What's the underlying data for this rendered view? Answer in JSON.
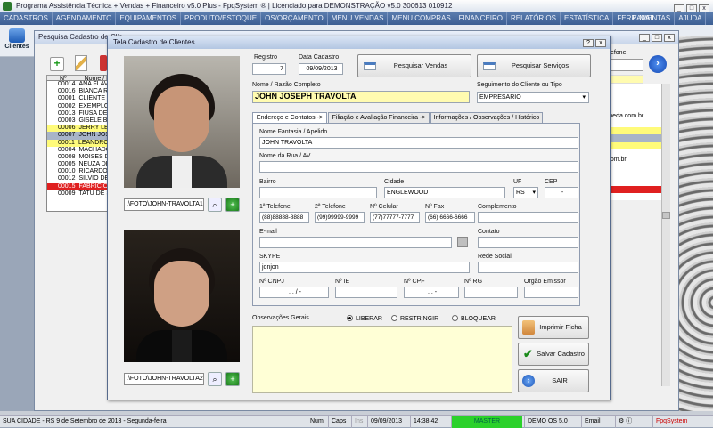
{
  "app_title": "Programa Assistência Técnica + Vendas + Financeiro v5.0 Plus - FpqSystem ® | Licenciado para  DEMONSTRAÇÃO v5.0 300613 010912",
  "menu": [
    "CADASTROS",
    "AGENDAMENTO",
    "EQUIPAMENTOS",
    "PRODUTO/ESTOQUE",
    "OS/ORÇAMENTO",
    "MENU VENDAS",
    "MENU COMPRAS",
    "FINANCEIRO",
    "RELATÓRIOS",
    "ESTATÍSTICA",
    "FERRAMENTAS",
    "AJUDA"
  ],
  "menu_email": "E-MAIL",
  "toolbar": {
    "clientes": "Clientes"
  },
  "bg_window": {
    "title": "Pesquisa Cadastro de Clie",
    "col_n": "Nº",
    "col_nome": "Nome / Ra",
    "rows": [
      {
        "n": "00014",
        "nome": "ANA FLAVI"
      },
      {
        "n": "00016",
        "nome": "BIANCA RA"
      },
      {
        "n": "00001",
        "nome": "CLIENTE D"
      },
      {
        "n": "00002",
        "nome": "EXEMPLO"
      },
      {
        "n": "00013",
        "nome": "FIUSA DE"
      },
      {
        "n": "00003",
        "nome": "GISELE BU"
      },
      {
        "n": "00006",
        "nome": "JERRY LE"
      },
      {
        "n": "00007",
        "nome": "JOHN JOS"
      },
      {
        "n": "00011",
        "nome": "LEANDRO"
      },
      {
        "n": "00004",
        "nome": "MACHADO"
      },
      {
        "n": "00008",
        "nome": "MOISES DE"
      },
      {
        "n": "00005",
        "nome": "NEUZA DE"
      },
      {
        "n": "00010",
        "nome": "RICARDO A"
      },
      {
        "n": "00012",
        "nome": "SILVIO DE"
      },
      {
        "n": "00015",
        "nome": "FABRICIO"
      },
      {
        "n": "00009",
        "nome": "TATU DE S"
      }
    ],
    "right_header": "Telefone",
    "right_rows": [
      "m.br",
      "",
      "m.br",
      "",
      "ealmeda.com.br",
      "",
      "",
      "",
      "",
      "",
      "es.com.br",
      "m.br",
      "",
      "",
      "",
      ""
    ]
  },
  "form": {
    "title": "Tela Cadastro de Clientes",
    "foto1": ".\\FOTO\\JOHN-TRAVOLTA1.",
    "foto2": ".\\FOTO\\JOHN-TRAVOLTA2.",
    "registro_label": "Registro",
    "registro": "7",
    "data_label": "Data Cadastro",
    "data": "09/09/2013",
    "pesq_vendas": "Pesquisar Vendas",
    "pesq_servicos": "Pesquisar Serviços",
    "nome_label": "Nome / Razão Completo",
    "nome": "JOHN JOSEPH TRAVOLTA",
    "seg_label": "Seguimento do Cliente ou Tipo",
    "seg": "EMPRESARIO",
    "tabs": [
      "Endereço e Contatos ->",
      "Filiação e Avaliação Financeira ->",
      "Informações / Observações / Histórico"
    ],
    "fantasia_label": "Nome Fantasia / Apelido",
    "fantasia": "JOHN TRAVOLTA",
    "rua_label": "Nome da Rua / AV",
    "rua": "",
    "bairro_label": "Bairro",
    "bairro": "",
    "cidade_label": "Cidade",
    "cidade": "ENGLEWOOD",
    "uf_label": "UF",
    "uf": "RS",
    "cep_label": "CEP",
    "cep": "-",
    "tel1_label": "1ª Telefone",
    "tel1": "(88)88888-8888",
    "tel2_label": "2ª Telefone",
    "tel2": "(99)99999-9999",
    "cel_label": "Nº Celular",
    "cel": "(77)77777-7777",
    "fax_label": "Nº Fax",
    "fax": "(66) 6666-6666",
    "compl_label": "Complemento",
    "compl": "",
    "email_label": "E-mail",
    "email": "",
    "contato_label": "Contato",
    "contato": "",
    "skype_label": "SKYPE",
    "skype": "jonjon",
    "rede_label": "Rede Social",
    "rede": "",
    "cnpj_label": "Nº CNPJ",
    "cnpj": ". . / -",
    "ie_label": "Nº IE",
    "ie": "",
    "cpf_label": "Nº CPF",
    "cpf": ". . -",
    "rg_label": "Nº RG",
    "rg": "",
    "orgao_label": "Orgão Emissor",
    "orgao": "",
    "obs_label": "Observações Gerais",
    "radios": [
      "LIBERAR",
      "RESTRINGIR",
      "BLOQUEAR"
    ],
    "imprimir": "Imprimir Ficha",
    "salvar": "Salvar Cadastro",
    "sair": "SAIR"
  },
  "status": {
    "city": "SUA CIDADE - RS  9 de Setembro de 2013 - Segunda-feira",
    "num": "Num",
    "caps": "Caps",
    "ins": "Ins",
    "date": "09/09/2013",
    "time": "14:38:42",
    "master": "MASTER",
    "demo": "DEMO OS 5.0",
    "email": "Email",
    "brand": "FpqSystem"
  }
}
